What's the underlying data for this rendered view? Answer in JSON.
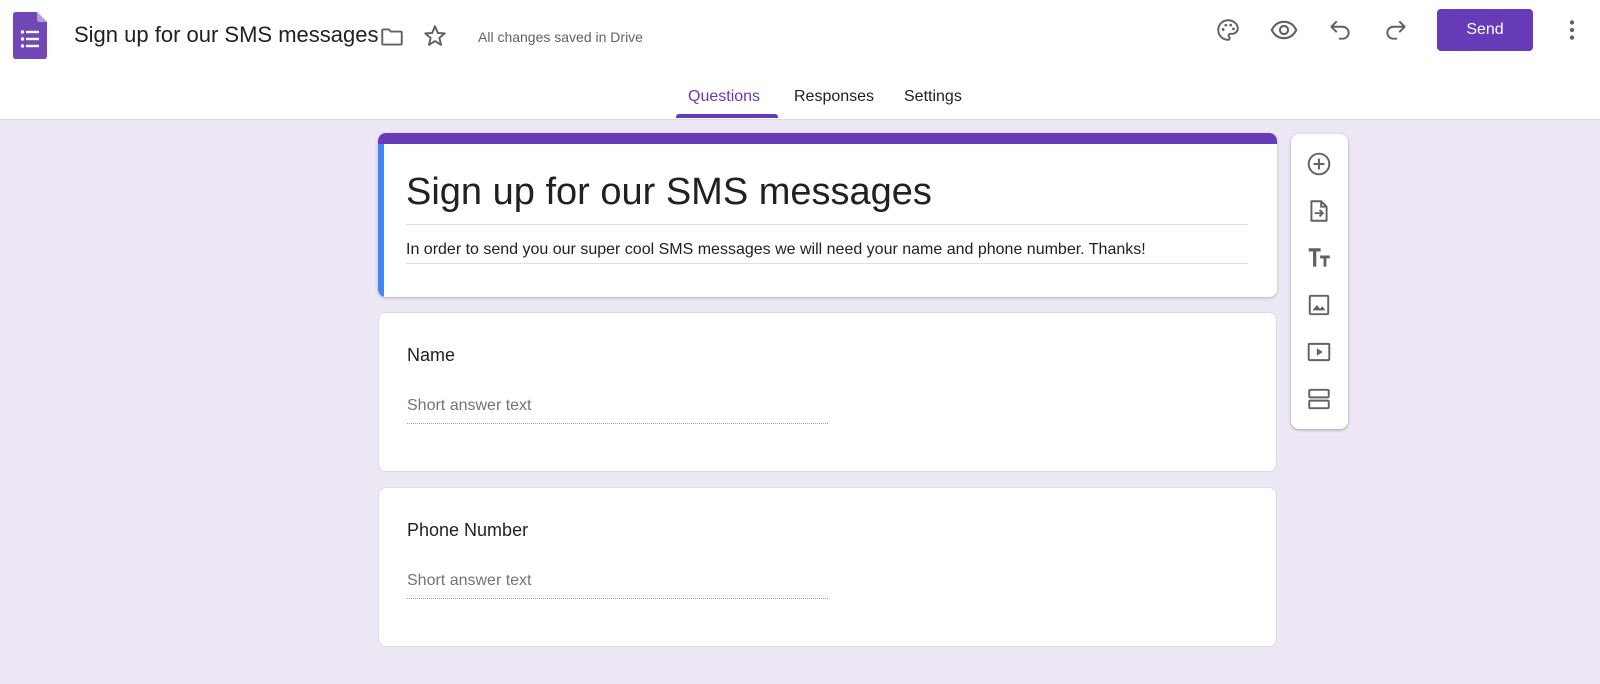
{
  "header": {
    "doc_title": "Sign up for our SMS messages",
    "save_status": "All changes saved in Drive",
    "send_label": "Send",
    "icons": [
      "forms-logo-icon",
      "folder-icon",
      "star-icon",
      "palette-icon",
      "eye-icon",
      "undo-icon",
      "redo-icon",
      "more-vert-icon"
    ]
  },
  "tabs": [
    {
      "label": "Questions",
      "active": true
    },
    {
      "label": "Responses",
      "active": false
    },
    {
      "label": "Settings",
      "active": false
    }
  ],
  "form": {
    "title": "Sign up for our SMS messages",
    "description": "In order to send you our super cool SMS messages we will need your name and phone number. Thanks!"
  },
  "questions": [
    {
      "title": "Name",
      "placeholder": "Short answer text"
    },
    {
      "title": "Phone Number",
      "placeholder": "Short answer text"
    }
  ],
  "toolbar": {
    "icons": [
      "add-question-icon",
      "import-questions-icon",
      "add-title-icon",
      "add-image-icon",
      "add-video-icon",
      "add-section-icon"
    ]
  },
  "colors": {
    "brand": "#673ab7",
    "accent_blue": "#4285f4",
    "page_bg": "#ede7f6"
  }
}
